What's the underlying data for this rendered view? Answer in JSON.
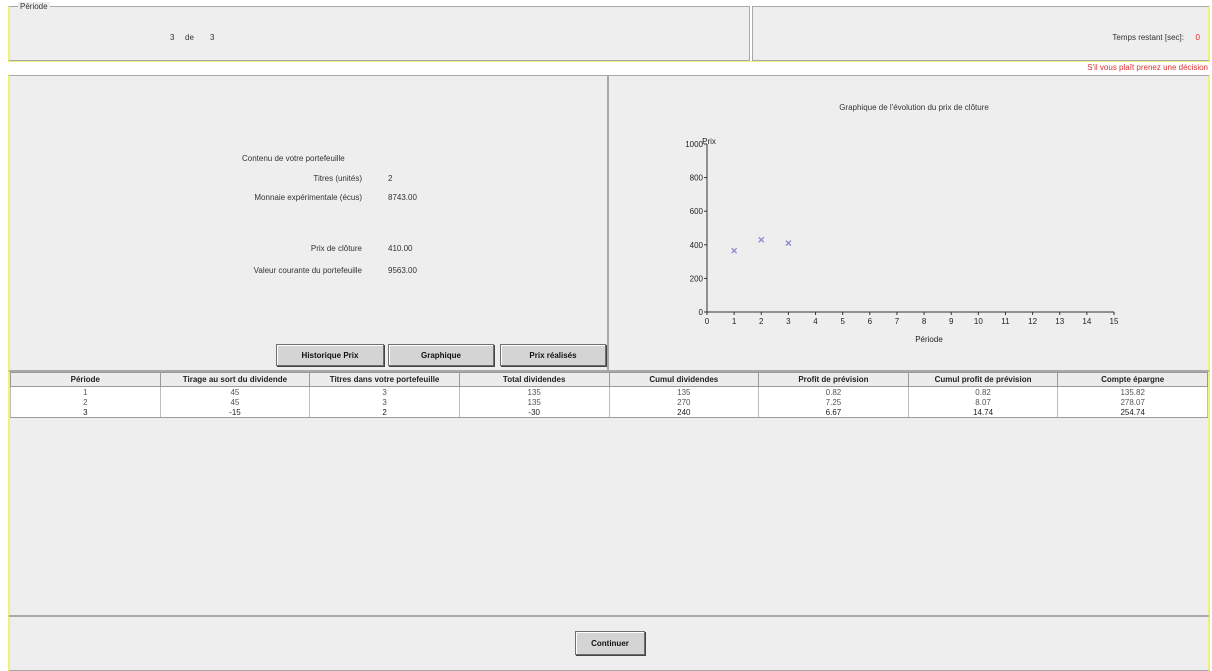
{
  "header": {
    "period_legend": "Période",
    "current_period": "3",
    "of_label": "de",
    "total_periods": "3",
    "time_label": "Temps restant [sec]:",
    "time_value": "0",
    "warning": "S'il vous plaît prenez une décision"
  },
  "portfolio": {
    "title": "Contenu de votre portefeuille",
    "titles_label": "Titres (unités)",
    "titles_value": "2",
    "money_label": "Monnaie expérimentale (écus)",
    "money_value": "8743.00",
    "close_price_label": "Prix de clôture",
    "close_price_value": "410.00",
    "current_value_label": "Valeur courante du portefeuille",
    "current_value_value": "9563.00"
  },
  "buttons": {
    "history": "Historique Prix",
    "graph": "Graphique",
    "realized": "Prix réalisés",
    "continue": "Continuer"
  },
  "chart_data": {
    "type": "scatter",
    "title": "Graphique de l'évolution du prix de clôture",
    "xlabel": "Période",
    "ylabel": "Prix",
    "xlim": [
      0,
      15
    ],
    "ylim": [
      0,
      1000
    ],
    "xticks": [
      0,
      1,
      2,
      3,
      4,
      5,
      6,
      7,
      8,
      9,
      10,
      11,
      12,
      13,
      14,
      15
    ],
    "yticks": [
      0,
      200,
      400,
      600,
      800,
      1000
    ],
    "x": [
      1,
      2,
      3
    ],
    "y": [
      365,
      430,
      410
    ],
    "marker_color": "#8a8ad0",
    "grid": false
  },
  "table": {
    "headers": [
      "Période",
      "Tirage au sort du dividende",
      "Titres dans votre portefeuille",
      "Total dividendes",
      "Cumul dividendes",
      "Profit de prévision",
      "Cumul profit de prévision",
      "Compte épargne"
    ],
    "rows": [
      [
        "1",
        "45",
        "3",
        "135",
        "135",
        "0.82",
        "0.82",
        "135.82"
      ],
      [
        "2",
        "45",
        "3",
        "135",
        "270",
        "7.25",
        "8.07",
        "278.07"
      ],
      [
        "3",
        "-15",
        "2",
        "-30",
        "240",
        "6.67",
        "14.74",
        "254.74"
      ]
    ]
  },
  "colors": {
    "panel": "#eeeeee",
    "accent_yellow": "#f0f07a",
    "warning_red": "#e03030"
  }
}
